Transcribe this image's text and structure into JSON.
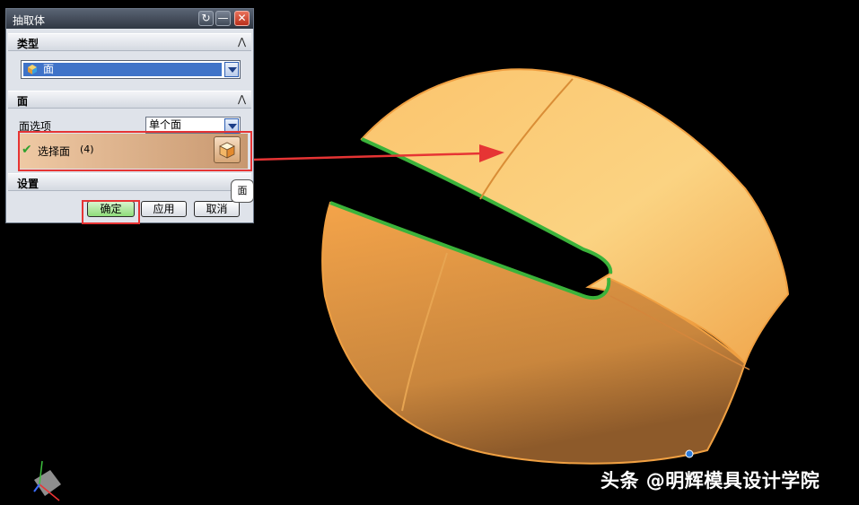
{
  "dialog": {
    "title": "抽取体",
    "title_buttons": [
      "refresh-icon",
      "minimize-icon",
      "close-icon"
    ],
    "sections": {
      "type": {
        "title": "类型",
        "selected": "面"
      },
      "face": {
        "title": "面",
        "face_option_label": "面选项",
        "face_option_value": "单个面",
        "select_label": "选择面",
        "select_count": "(4)"
      },
      "settings": {
        "title": "设置"
      }
    },
    "buttons": {
      "ok": "确定",
      "apply": "应用",
      "cancel": "取消"
    }
  },
  "tooltip": "面",
  "watermark": "头条 @明辉模具设计学院",
  "colors": {
    "face_orange": "#f5b459",
    "edge_green": "#3bb33b",
    "highlight_red": "#e63434",
    "selection_blue": "#3f73c8"
  }
}
